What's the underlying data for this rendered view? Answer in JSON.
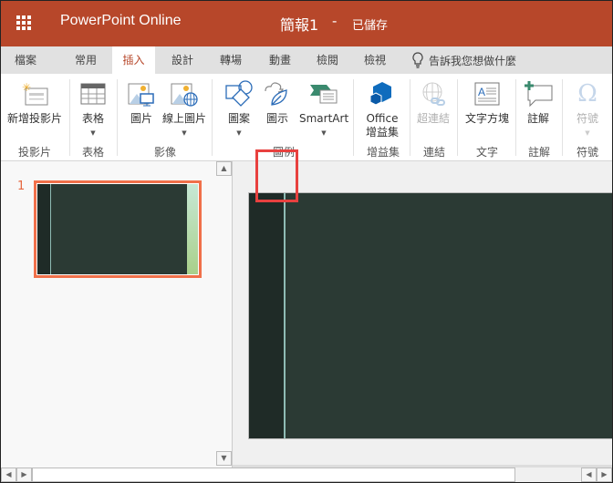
{
  "header": {
    "app_name": "PowerPoint Online",
    "doc_name": "簡報1",
    "separator": "-",
    "save_status": "已儲存"
  },
  "tabs": [
    {
      "label": "檔案"
    },
    {
      "label": "常用"
    },
    {
      "label": "插入",
      "active": true
    },
    {
      "label": "設計"
    },
    {
      "label": "轉場"
    },
    {
      "label": "動畫"
    },
    {
      "label": "檢閱"
    },
    {
      "label": "檢視"
    }
  ],
  "tell_me": "告訴我您想做什麼",
  "ribbon": {
    "buttons": {
      "new_slide": "新增投影片",
      "table": "表格",
      "picture": "圖片",
      "online_picture": "線上圖片",
      "shapes": "圖案",
      "icons": "圖示",
      "smartart": "SmartArt",
      "office_addins_1": "Office",
      "office_addins_2": "增益集",
      "hyperlink": "超連結",
      "textbox": "文字方塊",
      "comment": "註解",
      "symbol": "符號"
    },
    "groups": {
      "slides": "投影片",
      "tables": "表格",
      "images": "影像",
      "illustrations": "圖例",
      "addins": "增益集",
      "links": "連結",
      "text": "文字",
      "comments": "註解",
      "symbols": "符號"
    },
    "highlighted": "圖示"
  },
  "slides_pane": {
    "slide_number": "1"
  },
  "colors": {
    "brand": "#b7472a",
    "highlight": "#e8413f",
    "selection": "#f0704a"
  }
}
